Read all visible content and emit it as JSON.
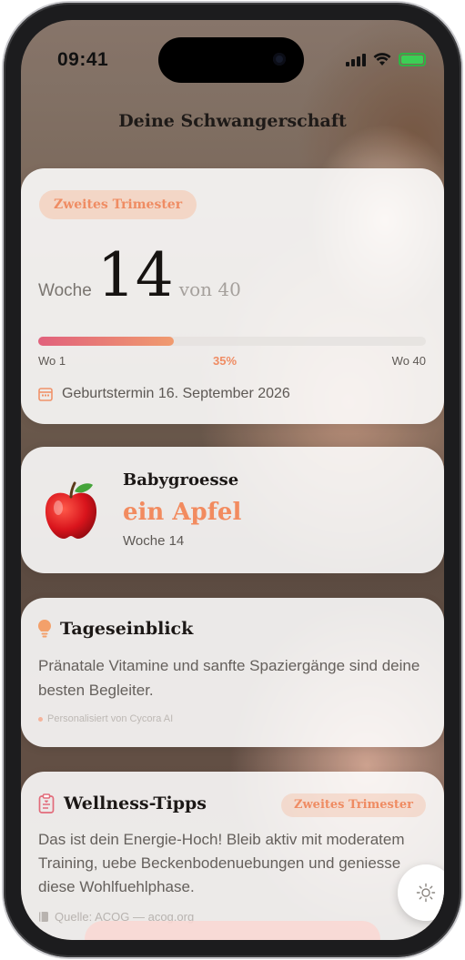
{
  "status_bar": {
    "time": "09:41"
  },
  "page": {
    "title": "Deine Schwangerschaft"
  },
  "trimester_card": {
    "trimester_badge": "Zweites Trimester",
    "week_word": "Woche",
    "week_number": "14",
    "week_of": "von 40",
    "progress_percent": 35,
    "progress_label": "35%",
    "progress_start": "Wo 1",
    "progress_end": "Wo 40",
    "due_date": "Geburtstermin 16. September 2026"
  },
  "baby_card": {
    "label": "Babygroesse",
    "value": "ein Apfel",
    "week": "Woche 14",
    "icon": "apple-icon"
  },
  "insight_card": {
    "title": "Tageseinblick",
    "body": "Pränatale Vitamine und sanfte Spaziergänge sind deine besten Begleiter.",
    "footer": "Personalisiert von Cycora AI",
    "icon": "lightbulb-icon"
  },
  "wellness_card": {
    "title": "Wellness-Tipps",
    "badge": "Zweites Trimester",
    "body": "Das ist dein Energie-Hoch! Bleib aktiv mit moderatem Training, uebe Beckenbodenuebungen und geniesse diese Wohlfuehlphase.",
    "source": "Quelle: ACOG — acog.org",
    "icon": "clipboard-icon"
  },
  "colors": {
    "accent": "#ef8c63",
    "progress_start": "#e1617c",
    "progress_end": "#f09b6f"
  }
}
